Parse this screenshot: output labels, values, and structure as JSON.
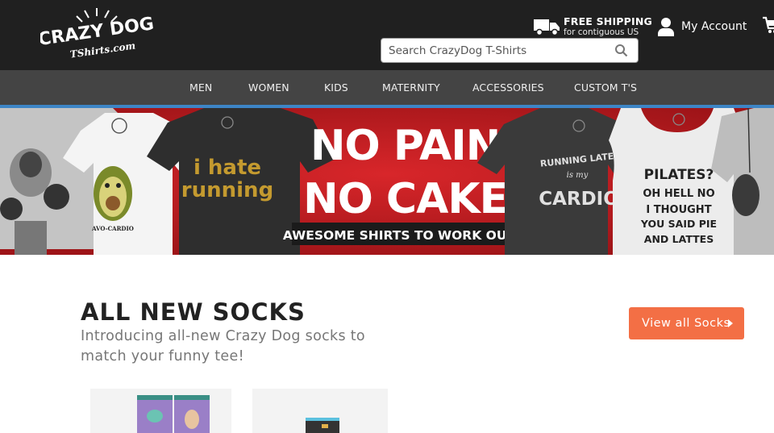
{
  "header": {
    "logo": {
      "line1": "CRAZY DOG",
      "line2": "TShirts.com"
    },
    "shipping": {
      "title": "FREE SHIPPING",
      "subtitle": "for contiguous US",
      "icon": "truck-icon"
    },
    "account_label": "My Account",
    "search_placeholder": "Search CrazyDog T-Shirts",
    "cart_icon": "cart-icon"
  },
  "nav": {
    "items": [
      {
        "label": "MEN"
      },
      {
        "label": "WOMEN"
      },
      {
        "label": "KIDS"
      },
      {
        "label": "MATERNITY"
      },
      {
        "label": "ACCESSORIES"
      },
      {
        "label": "CUSTOM T'S"
      }
    ]
  },
  "banner": {
    "headline1": "NO PAIN.",
    "headline2": "NO CAKE.",
    "tagline": "AWESOME SHIRTS TO WORK OUT IN",
    "shirts": {
      "avocado_caption": "AVO-CARDIO",
      "hate_running_1": "i hate",
      "hate_running_2": "running",
      "cardio_1": "RUNNING LATE",
      "cardio_2": "is my",
      "cardio_3": "CARDIO",
      "pilates_1": "PILATES?",
      "pilates_2": "OH HELL NO",
      "pilates_3": "I THOUGHT",
      "pilates_4": "YOU SAID PIE",
      "pilates_5": "AND LATTES"
    }
  },
  "socks_section": {
    "title": "ALL NEW SOCKS",
    "subtitle": "Introducing all-new Crazy Dog socks to match your funny tee!",
    "cta_label": "View all Socks"
  },
  "colors": {
    "topbar": "#202020",
    "nav": "#444444",
    "accent_blue": "#3d85c6",
    "banner_red": "#bf1e22",
    "cta_orange": "#f36f45"
  }
}
